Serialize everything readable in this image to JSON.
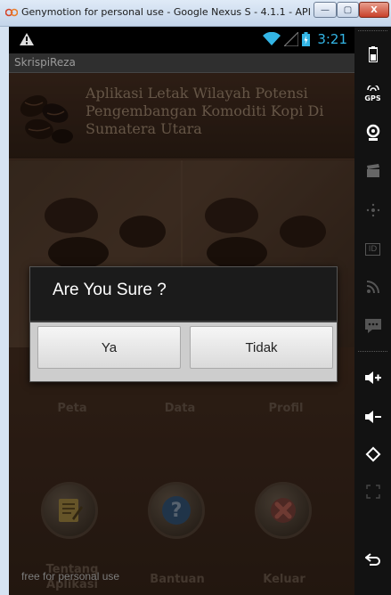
{
  "window": {
    "title": "Genymotion for personal use - Google Nexus S - 4.1.1 - API 1...",
    "btn_minimize": "—",
    "btn_maximize": "▢",
    "btn_close": "X"
  },
  "statusbar": {
    "time": "3:21"
  },
  "app": {
    "name": "SkrispiReza",
    "header_title": "Aplikasi Letak Wilayah Potensi Pengembangan Komoditi Kopi Di Sumatera Utara",
    "menu_top": [
      "Peta",
      "Data",
      "Profil"
    ],
    "menu_bottom": [
      "Tentang Aplikasi",
      "Bantuan",
      "Keluar"
    ]
  },
  "dialog": {
    "title": "Are You Sure ?",
    "yes": "Ya",
    "no": "Tidak"
  },
  "watermark": "free for personal use",
  "sidebar": {
    "gps_label": "GPS",
    "id_label": "ID"
  }
}
